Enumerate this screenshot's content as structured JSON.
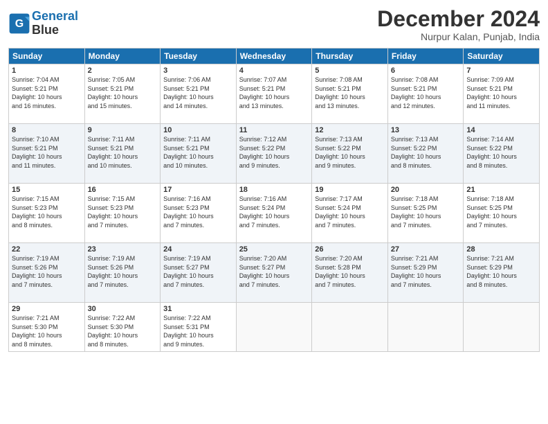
{
  "header": {
    "logo_line1": "General",
    "logo_line2": "Blue",
    "month": "December 2024",
    "location": "Nurpur Kalan, Punjab, India"
  },
  "weekdays": [
    "Sunday",
    "Monday",
    "Tuesday",
    "Wednesday",
    "Thursday",
    "Friday",
    "Saturday"
  ],
  "weeks": [
    [
      {
        "day": "1",
        "info": "Sunrise: 7:04 AM\nSunset: 5:21 PM\nDaylight: 10 hours\nand 16 minutes."
      },
      {
        "day": "2",
        "info": "Sunrise: 7:05 AM\nSunset: 5:21 PM\nDaylight: 10 hours\nand 15 minutes."
      },
      {
        "day": "3",
        "info": "Sunrise: 7:06 AM\nSunset: 5:21 PM\nDaylight: 10 hours\nand 14 minutes."
      },
      {
        "day": "4",
        "info": "Sunrise: 7:07 AM\nSunset: 5:21 PM\nDaylight: 10 hours\nand 13 minutes."
      },
      {
        "day": "5",
        "info": "Sunrise: 7:08 AM\nSunset: 5:21 PM\nDaylight: 10 hours\nand 13 minutes."
      },
      {
        "day": "6",
        "info": "Sunrise: 7:08 AM\nSunset: 5:21 PM\nDaylight: 10 hours\nand 12 minutes."
      },
      {
        "day": "7",
        "info": "Sunrise: 7:09 AM\nSunset: 5:21 PM\nDaylight: 10 hours\nand 11 minutes."
      }
    ],
    [
      {
        "day": "8",
        "info": "Sunrise: 7:10 AM\nSunset: 5:21 PM\nDaylight: 10 hours\nand 11 minutes."
      },
      {
        "day": "9",
        "info": "Sunrise: 7:11 AM\nSunset: 5:21 PM\nDaylight: 10 hours\nand 10 minutes."
      },
      {
        "day": "10",
        "info": "Sunrise: 7:11 AM\nSunset: 5:21 PM\nDaylight: 10 hours\nand 10 minutes."
      },
      {
        "day": "11",
        "info": "Sunrise: 7:12 AM\nSunset: 5:22 PM\nDaylight: 10 hours\nand 9 minutes."
      },
      {
        "day": "12",
        "info": "Sunrise: 7:13 AM\nSunset: 5:22 PM\nDaylight: 10 hours\nand 9 minutes."
      },
      {
        "day": "13",
        "info": "Sunrise: 7:13 AM\nSunset: 5:22 PM\nDaylight: 10 hours\nand 8 minutes."
      },
      {
        "day": "14",
        "info": "Sunrise: 7:14 AM\nSunset: 5:22 PM\nDaylight: 10 hours\nand 8 minutes."
      }
    ],
    [
      {
        "day": "15",
        "info": "Sunrise: 7:15 AM\nSunset: 5:23 PM\nDaylight: 10 hours\nand 8 minutes."
      },
      {
        "day": "16",
        "info": "Sunrise: 7:15 AM\nSunset: 5:23 PM\nDaylight: 10 hours\nand 7 minutes."
      },
      {
        "day": "17",
        "info": "Sunrise: 7:16 AM\nSunset: 5:23 PM\nDaylight: 10 hours\nand 7 minutes."
      },
      {
        "day": "18",
        "info": "Sunrise: 7:16 AM\nSunset: 5:24 PM\nDaylight: 10 hours\nand 7 minutes."
      },
      {
        "day": "19",
        "info": "Sunrise: 7:17 AM\nSunset: 5:24 PM\nDaylight: 10 hours\nand 7 minutes."
      },
      {
        "day": "20",
        "info": "Sunrise: 7:18 AM\nSunset: 5:25 PM\nDaylight: 10 hours\nand 7 minutes."
      },
      {
        "day": "21",
        "info": "Sunrise: 7:18 AM\nSunset: 5:25 PM\nDaylight: 10 hours\nand 7 minutes."
      }
    ],
    [
      {
        "day": "22",
        "info": "Sunrise: 7:19 AM\nSunset: 5:26 PM\nDaylight: 10 hours\nand 7 minutes."
      },
      {
        "day": "23",
        "info": "Sunrise: 7:19 AM\nSunset: 5:26 PM\nDaylight: 10 hours\nand 7 minutes."
      },
      {
        "day": "24",
        "info": "Sunrise: 7:19 AM\nSunset: 5:27 PM\nDaylight: 10 hours\nand 7 minutes."
      },
      {
        "day": "25",
        "info": "Sunrise: 7:20 AM\nSunset: 5:27 PM\nDaylight: 10 hours\nand 7 minutes."
      },
      {
        "day": "26",
        "info": "Sunrise: 7:20 AM\nSunset: 5:28 PM\nDaylight: 10 hours\nand 7 minutes."
      },
      {
        "day": "27",
        "info": "Sunrise: 7:21 AM\nSunset: 5:29 PM\nDaylight: 10 hours\nand 7 minutes."
      },
      {
        "day": "28",
        "info": "Sunrise: 7:21 AM\nSunset: 5:29 PM\nDaylight: 10 hours\nand 8 minutes."
      }
    ],
    [
      {
        "day": "29",
        "info": "Sunrise: 7:21 AM\nSunset: 5:30 PM\nDaylight: 10 hours\nand 8 minutes."
      },
      {
        "day": "30",
        "info": "Sunrise: 7:22 AM\nSunset: 5:30 PM\nDaylight: 10 hours\nand 8 minutes."
      },
      {
        "day": "31",
        "info": "Sunrise: 7:22 AM\nSunset: 5:31 PM\nDaylight: 10 hours\nand 9 minutes."
      },
      {
        "day": "",
        "info": ""
      },
      {
        "day": "",
        "info": ""
      },
      {
        "day": "",
        "info": ""
      },
      {
        "day": "",
        "info": ""
      }
    ]
  ]
}
